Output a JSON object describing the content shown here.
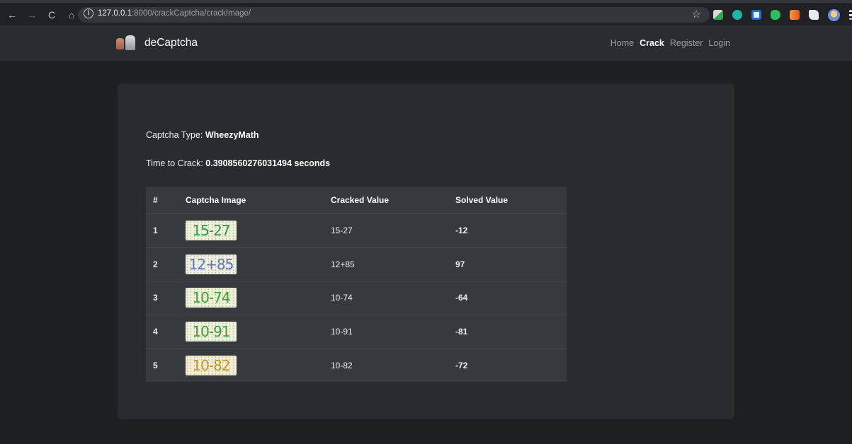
{
  "browser": {
    "url_host": "127.0.0.1",
    "url_rest": ":8000/crackCaptcha/crackImage/",
    "nav": {
      "back": "←",
      "forward": "→",
      "reload": "C",
      "home": "⌂"
    },
    "info_icon": "i",
    "star_icon": "☆"
  },
  "site": {
    "brand": "deCaptcha",
    "nav": [
      {
        "label": "Home",
        "active": false
      },
      {
        "label": "Crack",
        "active": true
      },
      {
        "label": "Register",
        "active": false
      },
      {
        "label": "Login",
        "active": false
      }
    ]
  },
  "result": {
    "type_label": "Captcha Type: ",
    "type_value": "WheezyMath",
    "time_label": "Time to Crack: ",
    "time_value": "0.3908560276031494 seconds"
  },
  "table": {
    "headers": [
      "#",
      "Captcha Image",
      "Cracked Value",
      "Solved Value"
    ],
    "rows": [
      {
        "idx": "1",
        "captcha_text": "15-27",
        "cracked": "15-27",
        "solved": "-12",
        "color": "#2e9b46",
        "bg": "#eef2da"
      },
      {
        "idx": "2",
        "captcha_text": "12+85",
        "cracked": "12+85",
        "solved": "97",
        "color": "#5a79b8",
        "bg": "#f0efe3"
      },
      {
        "idx": "3",
        "captcha_text": "10-74",
        "cracked": "10-74",
        "solved": "-64",
        "color": "#3ea43a",
        "bg": "#eef3d8"
      },
      {
        "idx": "4",
        "captcha_text": "10-91",
        "cracked": "10-91",
        "solved": "-81",
        "color": "#3c9e3a",
        "bg": "#eff2dc"
      },
      {
        "idx": "5",
        "captcha_text": "10-82",
        "cracked": "10-82",
        "solved": "-72",
        "color": "#c69a2a",
        "bg": "#f2efd6"
      }
    ]
  }
}
